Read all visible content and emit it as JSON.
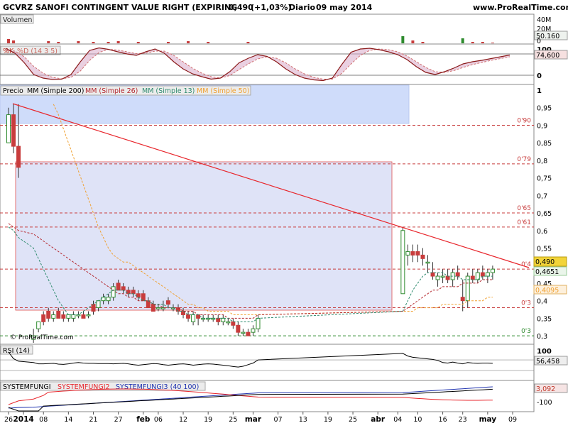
{
  "header": {
    "symbol": "GCVRZ",
    "name": "SANOFI CONTINGENT VALUE RIGHT (EXPIRING",
    "price": "0,490",
    "change": "(+1,03%)",
    "period": "Diario",
    "date": "09 may 2014",
    "site": "www.ProRealTime.com"
  },
  "watermark": "© ProRealTime.com",
  "chart_data": [
    {
      "type": "bar",
      "panel": "volume",
      "legend": [
        "Volumen"
      ],
      "axis_labels": [
        "40M",
        "20M",
        "0"
      ],
      "value_label": "50.160"
    },
    {
      "type": "line",
      "panel": "stochastic",
      "legend": [
        "%K",
        "%D (14 3 5)"
      ],
      "axis_labels": [
        "100",
        "0"
      ],
      "value_label": "74,600",
      "ylim": [
        0,
        100
      ],
      "k": [
        96,
        82,
        55,
        22,
        12,
        8,
        9,
        22,
        58,
        90,
        97,
        93,
        86,
        80,
        76,
        86,
        94,
        82,
        58,
        38,
        24,
        16,
        9,
        12,
        30,
        55,
        68,
        78,
        73,
        58,
        38,
        22,
        12,
        7,
        5,
        12,
        50,
        85,
        94,
        96,
        92,
        86,
        78,
        64,
        44,
        28,
        22,
        30,
        40,
        52,
        58,
        62,
        67,
        72,
        77
      ],
      "d": [
        90,
        88,
        72,
        45,
        26,
        14,
        10,
        14,
        32,
        62,
        84,
        93,
        91,
        86,
        81,
        82,
        88,
        88,
        76,
        58,
        40,
        26,
        16,
        12,
        19,
        36,
        52,
        66,
        72,
        68,
        55,
        38,
        24,
        14,
        9,
        9,
        25,
        52,
        76,
        90,
        94,
        92,
        86,
        74,
        58,
        42,
        30,
        28,
        33,
        42,
        50,
        56,
        62,
        67,
        72
      ]
    },
    {
      "type": "candlestick",
      "panel": "price",
      "legend": [
        "Precio",
        "MM (Simple 200)",
        "MM (Simple 26)",
        "MM (Simple 13)",
        "MM (Simple 50)"
      ],
      "ylim": [
        0.28,
        1.0
      ],
      "axis_labels": [
        "1",
        "0,95",
        "0,9",
        "0,85",
        "0,8",
        "0,75",
        "0,7",
        "0,65",
        "0,6",
        "0,55",
        "0,5",
        "0,45",
        "0,4",
        "0,35",
        "0,3"
      ],
      "price_tags": [
        "0,490",
        "0,4651",
        "0,4095"
      ],
      "level_labels": [
        "0'90",
        "0'79",
        "0'65",
        "0'61",
        "0'4",
        "0'3",
        "0'3"
      ],
      "levels": [
        0.9,
        0.79,
        0.65,
        0.61,
        0.49,
        0.38,
        0.3
      ],
      "ohlc": [
        [
          0.85,
          0.95,
          0.85,
          0.93
        ],
        [
          0.93,
          0.96,
          0.82,
          0.84
        ],
        [
          0.84,
          0.96,
          0.75,
          0.78
        ],
        [
          0.29,
          0.32,
          0.28,
          0.3
        ],
        [
          0.32,
          0.34,
          0.31,
          0.34
        ],
        [
          0.36,
          0.37,
          0.33,
          0.34
        ],
        [
          0.37,
          0.38,
          0.34,
          0.35
        ],
        [
          0.35,
          0.37,
          0.34,
          0.36
        ],
        [
          0.37,
          0.38,
          0.35,
          0.35
        ],
        [
          0.36,
          0.37,
          0.34,
          0.35
        ],
        [
          0.35,
          0.36,
          0.34,
          0.36
        ],
        [
          0.35,
          0.37,
          0.34,
          0.36
        ],
        [
          0.36,
          0.37,
          0.35,
          0.36
        ],
        [
          0.36,
          0.37,
          0.35,
          0.35
        ],
        [
          0.36,
          0.37,
          0.35,
          0.36
        ],
        [
          0.39,
          0.4,
          0.36,
          0.37
        ],
        [
          0.38,
          0.4,
          0.37,
          0.4
        ],
        [
          0.4,
          0.42,
          0.39,
          0.41
        ],
        [
          0.4,
          0.42,
          0.39,
          0.41
        ],
        [
          0.41,
          0.45,
          0.4,
          0.44
        ],
        [
          0.45,
          0.46,
          0.43,
          0.43
        ],
        [
          0.44,
          0.45,
          0.42,
          0.43
        ],
        [
          0.43,
          0.44,
          0.41,
          0.42
        ],
        [
          0.43,
          0.44,
          0.41,
          0.42
        ],
        [
          0.42,
          0.43,
          0.4,
          0.41
        ],
        [
          0.42,
          0.43,
          0.4,
          0.4
        ],
        [
          0.4,
          0.41,
          0.38,
          0.38
        ],
        [
          0.39,
          0.4,
          0.37,
          0.37
        ],
        [
          0.38,
          0.39,
          0.37,
          0.38
        ],
        [
          0.38,
          0.4,
          0.37,
          0.38
        ],
        [
          0.4,
          0.41,
          0.38,
          0.39
        ],
        [
          0.38,
          0.39,
          0.37,
          0.38
        ],
        [
          0.38,
          0.39,
          0.36,
          0.37
        ],
        [
          0.37,
          0.38,
          0.35,
          0.36
        ],
        [
          0.36,
          0.37,
          0.34,
          0.35
        ],
        [
          0.34,
          0.37,
          0.33,
          0.36
        ],
        [
          0.36,
          0.36,
          0.33,
          0.35
        ],
        [
          0.35,
          0.36,
          0.34,
          0.35
        ],
        [
          0.35,
          0.36,
          0.34,
          0.35
        ],
        [
          0.35,
          0.36,
          0.34,
          0.35
        ],
        [
          0.35,
          0.36,
          0.33,
          0.34
        ],
        [
          0.34,
          0.36,
          0.33,
          0.35
        ],
        [
          0.34,
          0.35,
          0.33,
          0.34
        ],
        [
          0.34,
          0.35,
          0.32,
          0.33
        ],
        [
          0.33,
          0.34,
          0.3,
          0.31
        ],
        [
          0.31,
          0.32,
          0.3,
          0.31
        ],
        [
          0.31,
          0.32,
          0.3,
          0.3
        ],
        [
          0.31,
          0.33,
          0.3,
          0.32
        ],
        [
          0.32,
          0.36,
          0.31,
          0.35
        ],
        [
          0.42,
          0.61,
          0.42,
          0.6
        ],
        [
          0.53,
          0.56,
          0.5,
          0.54
        ],
        [
          0.54,
          0.56,
          0.51,
          0.53
        ],
        [
          0.54,
          0.56,
          0.51,
          0.53
        ],
        [
          0.53,
          0.55,
          0.5,
          0.52
        ],
        [
          0.51,
          0.53,
          0.48,
          0.51
        ],
        [
          0.48,
          0.51,
          0.46,
          0.47
        ],
        [
          0.46,
          0.48,
          0.44,
          0.47
        ],
        [
          0.47,
          0.49,
          0.45,
          0.47
        ],
        [
          0.47,
          0.49,
          0.45,
          0.46
        ],
        [
          0.46,
          0.49,
          0.44,
          0.48
        ],
        [
          0.48,
          0.5,
          0.46,
          0.47
        ],
        [
          0.41,
          0.46,
          0.37,
          0.4
        ],
        [
          0.4,
          0.48,
          0.38,
          0.47
        ],
        [
          0.47,
          0.49,
          0.45,
          0.46
        ],
        [
          0.46,
          0.49,
          0.45,
          0.48
        ],
        [
          0.48,
          0.5,
          0.46,
          0.47
        ],
        [
          0.47,
          0.49,
          0.45,
          0.48
        ],
        [
          0.48,
          0.5,
          0.46,
          0.49
        ]
      ],
      "mm13": [
        0.61,
        0.6,
        0.58,
        0.55,
        0.52,
        0.49,
        0.46,
        0.43,
        0.4,
        0.38,
        0.36,
        0.36,
        0.36,
        0.37,
        0.38,
        0.39,
        0.4,
        0.41,
        0.42,
        0.43,
        0.43,
        0.43,
        0.42,
        0.42,
        0.41,
        0.4,
        0.4,
        0.39,
        0.39,
        0.39,
        0.38,
        0.38,
        0.37,
        0.37,
        0.36,
        0.36,
        0.36,
        0.35,
        0.35,
        0.35,
        0.35,
        0.35,
        0.35,
        0.34,
        0.34,
        0.34,
        0.34,
        0.34,
        0.35,
        0.37,
        0.4,
        0.43,
        0.45,
        0.47,
        0.48,
        0.48,
        0.48,
        0.48,
        0.47,
        0.47,
        0.47,
        0.46,
        0.46,
        0.46,
        0.46,
        0.47,
        0.47,
        0.47,
        0.47
      ],
      "mm26": [
        0.62,
        0.61,
        0.6,
        0.59,
        0.58,
        0.57,
        0.56,
        0.55,
        0.54,
        0.53,
        0.52,
        0.51,
        0.5,
        0.49,
        0.48,
        0.47,
        0.46,
        0.45,
        0.44,
        0.43,
        0.42,
        0.42,
        0.41,
        0.41,
        0.4,
        0.4,
        0.4,
        0.39,
        0.39,
        0.38,
        0.38,
        0.38,
        0.38,
        0.37,
        0.37,
        0.37,
        0.36,
        0.36,
        0.36,
        0.36,
        0.36,
        0.36,
        0.35,
        0.35,
        0.35,
        0.35,
        0.35,
        0.35,
        0.36,
        0.37,
        0.38,
        0.39,
        0.4,
        0.41,
        0.42,
        0.43,
        0.43,
        0.44,
        0.44,
        0.44,
        0.44,
        0.45,
        0.45,
        0.45,
        0.45,
        0.46,
        0.46,
        0.46,
        0.46
      ],
      "mm50": [
        null,
        null,
        null,
        null,
        null,
        null,
        null,
        0.96,
        0.93,
        0.89,
        0.85,
        0.81,
        0.77,
        0.73,
        0.69,
        0.65,
        0.61,
        0.58,
        0.55,
        0.53,
        0.52,
        0.51,
        0.51,
        0.5,
        0.49,
        0.48,
        0.47,
        0.46,
        0.45,
        0.44,
        0.43,
        0.42,
        0.41,
        0.4,
        0.39,
        0.39,
        0.38,
        0.38,
        0.37,
        0.37,
        0.37,
        0.37,
        0.37,
        0.36,
        0.36,
        0.36,
        0.36,
        0.36,
        0.36,
        0.37,
        0.37,
        0.37,
        0.38,
        0.38,
        0.38,
        0.38,
        0.38,
        0.39,
        0.39,
        0.39,
        0.39,
        0.39,
        0.4,
        0.4,
        0.4,
        0.4,
        0.41,
        0.41,
        0.41
      ]
    },
    {
      "type": "line",
      "panel": "rsi",
      "legend": [
        "RSI (14)"
      ],
      "axis_labels": [
        "100"
      ],
      "value_label": "56,458",
      "ylim": [
        0,
        100
      ],
      "values": [
        100,
        75,
        65,
        60,
        55,
        55,
        56,
        57,
        54,
        53,
        55,
        58,
        60,
        58,
        57,
        57,
        56,
        56,
        56,
        55,
        56,
        57,
        55,
        52,
        50,
        52,
        54,
        56,
        55,
        52,
        50,
        52,
        54,
        55,
        53,
        50,
        52,
        54,
        55,
        54,
        52,
        50,
        48,
        45,
        43,
        46,
        52,
        58,
        70,
        95,
        85,
        80,
        78,
        76,
        74,
        72,
        68,
        60,
        58,
        62,
        58,
        55,
        60,
        58,
        57,
        58,
        58,
        57,
        58
      ]
    },
    {
      "type": "line",
      "panel": "systemfungi",
      "legend": [
        "SYSTEMFUNGI",
        "SYSTEMFUNGI2",
        "SYSTEMFUNGI3 (40 100)"
      ],
      "axis_labels": [
        "-100"
      ],
      "value_label": "3,092"
    }
  ],
  "x_axis": {
    "ticks": [
      {
        "i": 0,
        "label": "26"
      },
      {
        "i": 3,
        "label": "2014",
        "bold": true
      },
      {
        "i": 7,
        "label": "08"
      },
      {
        "i": 12,
        "label": "14"
      },
      {
        "i": 17,
        "label": "21"
      },
      {
        "i": 22,
        "label": "27"
      },
      {
        "i": 27,
        "label": "feb",
        "bold": true
      },
      {
        "i": 30,
        "label": "06"
      },
      {
        "i": 35,
        "label": "12"
      },
      {
        "i": 40,
        "label": "19"
      },
      {
        "i": 45,
        "label": "25"
      },
      {
        "i": 49,
        "label": "mar",
        "bold": true
      },
      {
        "i": 54,
        "label": "07"
      },
      {
        "i": 59,
        "label": "13"
      },
      {
        "i": 64,
        "label": "19"
      },
      {
        "i": 69,
        "label": "25"
      },
      {
        "i": 74,
        "label": "abr",
        "bold": true
      },
      {
        "i": 78,
        "label": "04"
      },
      {
        "i": 82,
        "label": "10"
      },
      {
        "i": 87,
        "label": "16"
      },
      {
        "i": 91,
        "label": "23"
      },
      {
        "i": 96,
        "label": "may",
        "bold": true
      },
      {
        "i": 101,
        "label": "09"
      }
    ]
  },
  "colors": {
    "bull": "#2e8b2e",
    "bear": "#c83c3c",
    "trend": "#e8262c",
    "mm13": "#2e8b6e",
    "mm26": "#b4282e",
    "mm50": "#f0a030",
    "rect": "#d7ddf6",
    "grid": "#d8d8d8"
  }
}
